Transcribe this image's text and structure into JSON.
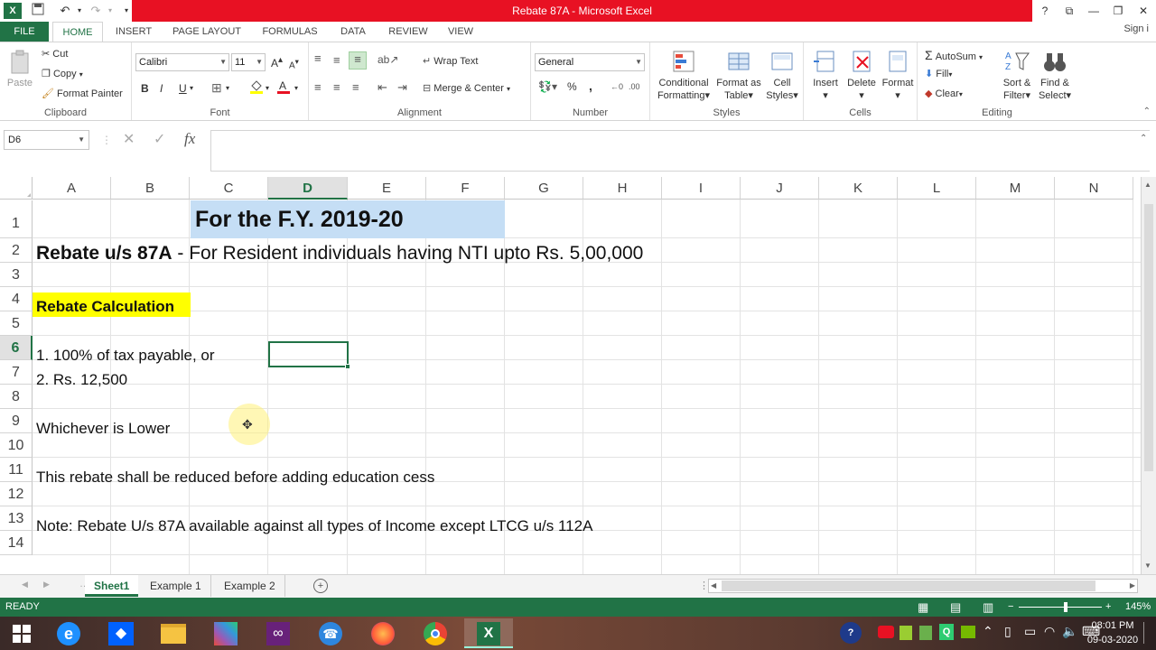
{
  "window": {
    "title": "Rebate 87A - Microsoft Excel",
    "controls": {
      "help": "?",
      "restore": "⧉",
      "minimize": "—",
      "maximize": "❐",
      "close": "✕"
    }
  },
  "tabs": [
    "FILE",
    "HOME",
    "INSERT",
    "PAGE LAYOUT",
    "FORMULAS",
    "DATA",
    "REVIEW",
    "VIEW"
  ],
  "signin": "Sign i",
  "ribbon": {
    "clipboard": {
      "label": "Clipboard",
      "paste": "Paste",
      "cut": "Cut",
      "copy": "Copy",
      "format_painter": "Format Painter"
    },
    "font": {
      "label": "Font",
      "name": "Calibri",
      "size": "11",
      "bold": "B",
      "italic": "I",
      "underline": "U"
    },
    "alignment": {
      "label": "Alignment",
      "wrap_text": "Wrap Text",
      "merge_center": "Merge & Center"
    },
    "number": {
      "label": "Number",
      "format": "General",
      "percent": "%",
      "comma": ","
    },
    "styles": {
      "label": "Styles",
      "conditional": "Conditional",
      "formatting": "Formatting",
      "format_as": "Format as",
      "table": "Table",
      "cell": "Cell",
      "styles": "Styles"
    },
    "cells": {
      "label": "Cells",
      "insert": "Insert",
      "delete": "Delete",
      "format": "Format"
    },
    "editing": {
      "label": "Editing",
      "autosum": "AutoSum",
      "fill": "Fill",
      "clear": "Clear",
      "sort": "Sort &",
      "filter": "Filter",
      "find": "Find &",
      "select": "Select"
    }
  },
  "formula_bar": {
    "name_box": "D6",
    "fx": "fx",
    "value": ""
  },
  "columns": [
    "A",
    "B",
    "C",
    "D",
    "E",
    "F",
    "G",
    "H",
    "I",
    "J",
    "K",
    "L",
    "M",
    "N"
  ],
  "active_column": "D",
  "rows": [
    "1",
    "2",
    "3",
    "4",
    "5",
    "6",
    "7",
    "8",
    "9",
    "10",
    "11",
    "12",
    "13",
    "14"
  ],
  "active_row": "6",
  "cells": {
    "c1": "For the F.Y. 2019-20",
    "r2_bold": "Rebate u/s 87A",
    "r2_rest": " - For Resident individuals having NTI upto Rs. 5,00,000",
    "a4": "Rebate Calculation",
    "a6": "1.  100% of tax payable,  or",
    "a7": "2.  Rs. 12,500",
    "a9": "Whichever is Lower",
    "a11": "This rebate shall be reduced before adding education cess",
    "a13": "Note: Rebate U/s 87A available against all types of Income except LTCG u/s 112A"
  },
  "sheets": [
    "Sheet1",
    "Example 1",
    "Example 2"
  ],
  "active_sheet": "Sheet1",
  "status": {
    "mode": "READY",
    "zoom": "145%"
  },
  "clock": {
    "time": "08:01 PM",
    "date": "09-03-2020"
  },
  "colors": {
    "excel_green": "#217346",
    "title_red": "#e81123",
    "highlight_yellow": "#ffff00",
    "title_blue": "#c5def5"
  }
}
